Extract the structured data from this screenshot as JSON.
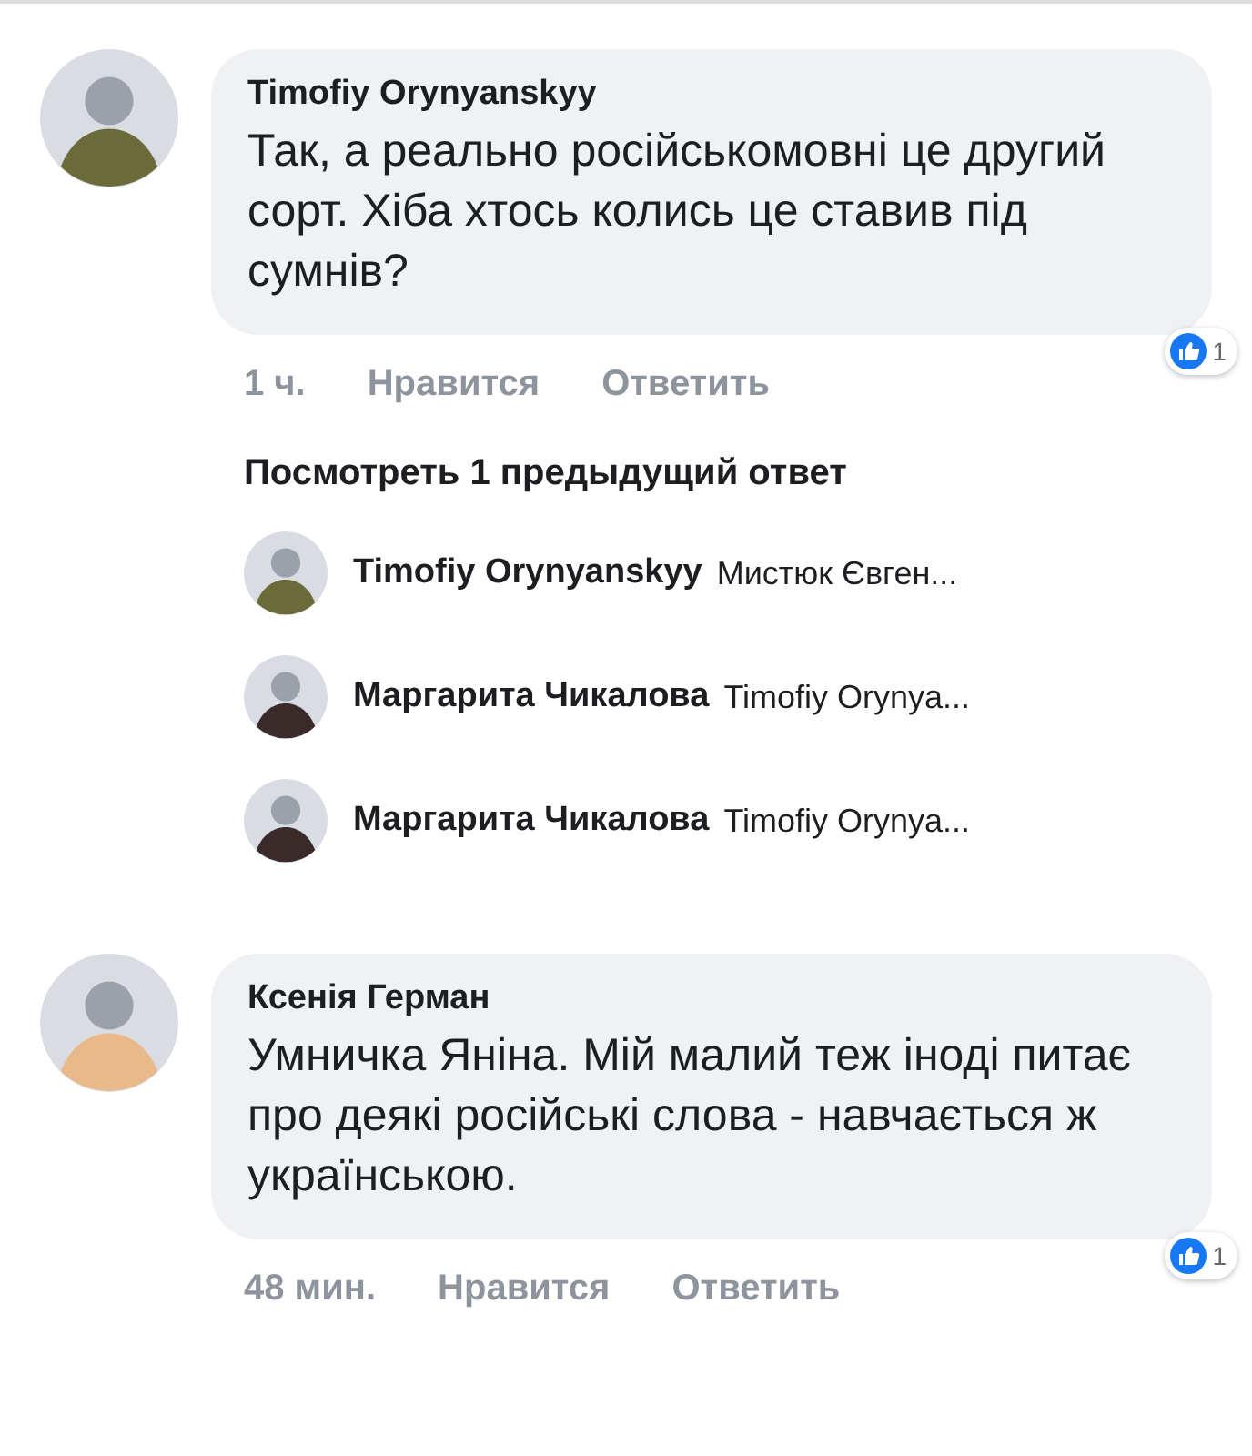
{
  "comments": [
    {
      "author": "Timofiy Orynyanskyy",
      "text": "Так, а реально російськомовні це другий сорт. Хіба хтось колись це ставив під сумнів?",
      "time": "1 ч.",
      "actions": [
        "Нравится",
        "Ответить"
      ],
      "reaction_count": "1",
      "more_replies": "Посмотреть 1 предыдущий ответ",
      "replies": [
        {
          "author": "Timofiy Orynyanskyy",
          "preview": "Мистюк Євген..."
        },
        {
          "author": "Маргарита Чикалова",
          "preview": "Timofiy Orynya..."
        },
        {
          "author": "Маргарита Чикалова",
          "preview": "Timofiy Orynya..."
        }
      ]
    },
    {
      "author": "Ксенія Герман",
      "text": "Умничка Яніна. Мій малий теж іноді питає про деякі російські слова - навчається ж українською.",
      "time": "48 мин.",
      "actions": [
        "Нравится",
        "Ответить"
      ],
      "reaction_count": "1"
    }
  ]
}
